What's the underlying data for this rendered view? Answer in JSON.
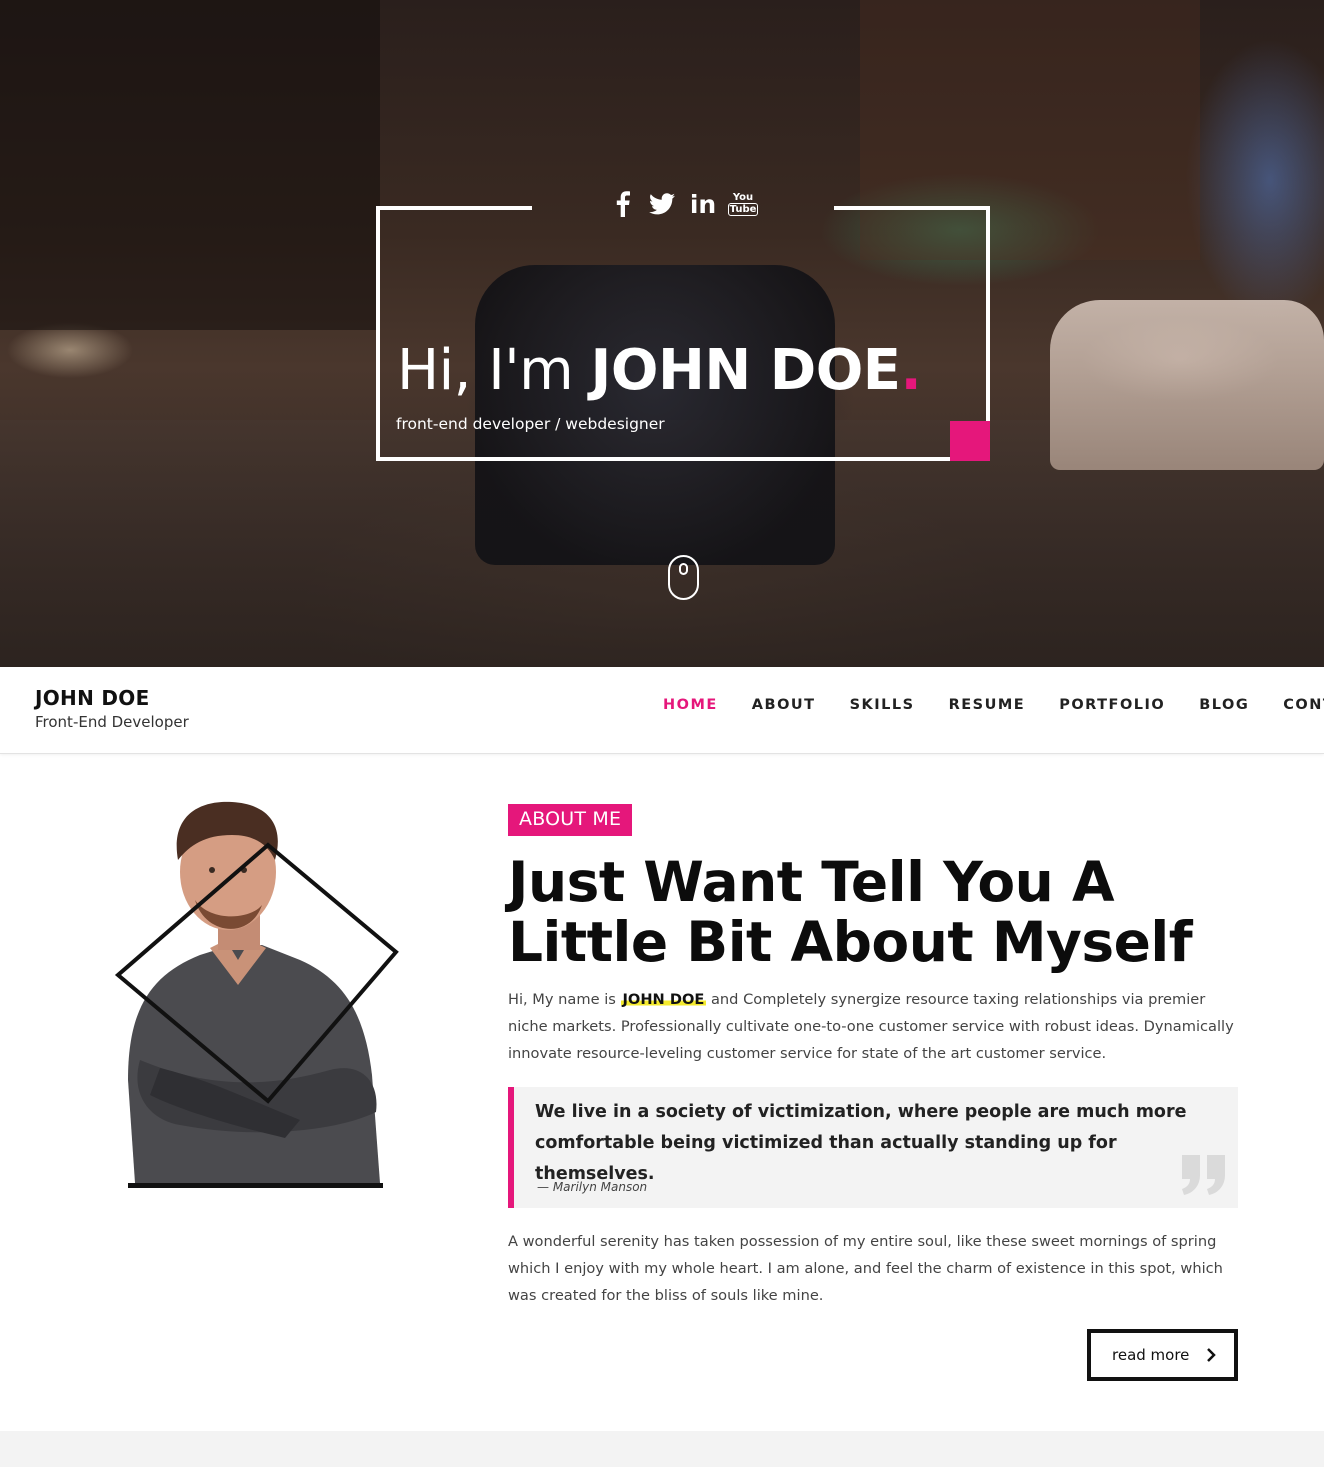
{
  "hero": {
    "greeting": "Hi, I'm ",
    "name": "JOHN DOE",
    "dot": ".",
    "subtitle": "front-end developer / webdesigner",
    "socials": [
      "facebook-icon",
      "twitter-icon",
      "linkedin-icon",
      "youtube-icon"
    ],
    "linkedin_text": "in",
    "youtube_text_top": "You",
    "youtube_text_bottom": "Tube",
    "accent_color": "#e5177b"
  },
  "header": {
    "brand_name": "JOHN DOE",
    "brand_role": "Front-End Developer",
    "nav": [
      {
        "label": "HOME",
        "active": true
      },
      {
        "label": "ABOUT",
        "active": false
      },
      {
        "label": "SKILLS",
        "active": false
      },
      {
        "label": "RESUME",
        "active": false
      },
      {
        "label": "PORTFOLIO",
        "active": false
      },
      {
        "label": "BLOG",
        "active": false
      },
      {
        "label": "CONTACT",
        "active": false
      }
    ]
  },
  "about": {
    "badge": "ABOUT ME",
    "title_line1": "Just Want Tell You A",
    "title_line2": "Little Bit About Myself",
    "intro_before": "Hi, My name is ",
    "intro_name": "JOHN DOE",
    "intro_after": " and Completely synergize resource taxing relationships via premier niche markets. Professionally cultivate one-to-one customer service with robust ideas. Dynamically innovate resource-leveling customer service for state of the art customer service.",
    "quote": "We live in a society of victimization, where people are much more comfortable being victimized than actually standing up for themselves.",
    "quote_author": "— Marilyn Manson",
    "paragraph2": "A wonderful serenity has taken possession of my entire soul, like these sweet mornings of spring which I enjoy with my whole heart. I am alone, and feel the charm of existence in this spot, which was created for the bliss of souls like mine.",
    "read_more": "read more",
    "highlight_color": "#f4ea2e"
  }
}
